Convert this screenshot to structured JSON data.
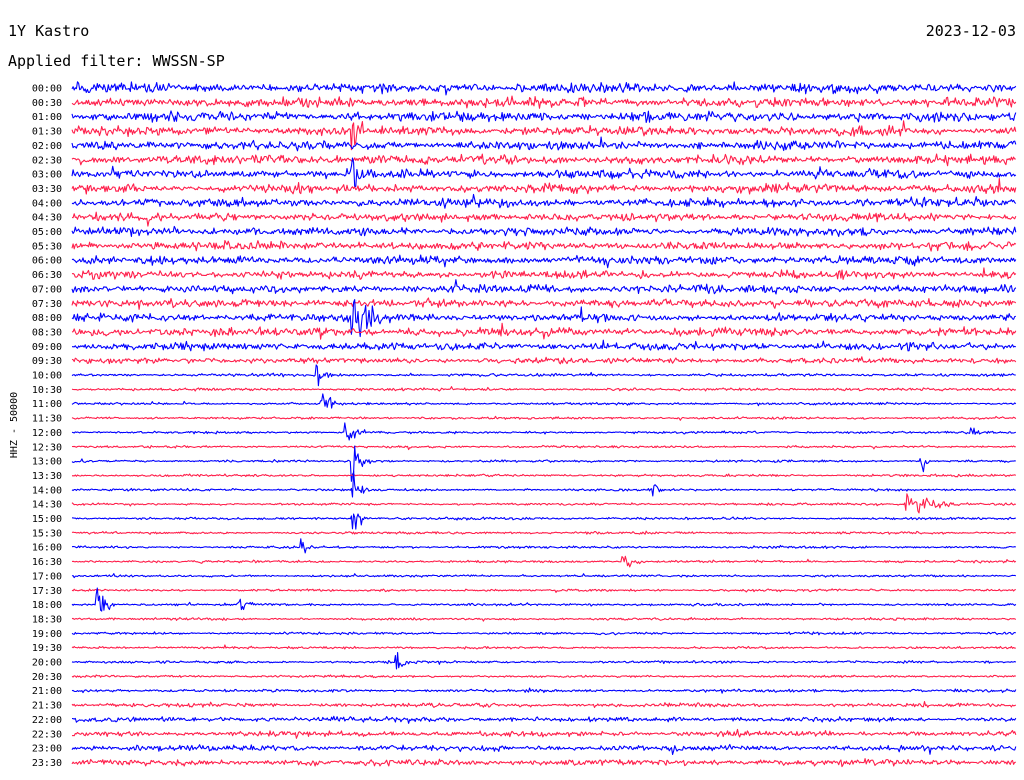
{
  "header": {
    "station": "1Y Kastro",
    "date": "2023-12-03",
    "filter": "Applied filter: WWSSN-SP"
  },
  "chart_data": {
    "type": "line",
    "title": "1Y Kastro",
    "subtitle": "Applied filter: WWSSN-SP",
    "date": "2023-12-03",
    "ylabel": "HHZ - 50000",
    "xlabel": "",
    "grid": false,
    "legend": "none",
    "trace_colors": [
      "#0000ff",
      "#ff1f4b"
    ],
    "row_minutes": 30,
    "ticks": [
      "00:00",
      "00:30",
      "01:00",
      "01:30",
      "02:00",
      "02:30",
      "03:00",
      "03:30",
      "04:00",
      "04:30",
      "05:00",
      "05:30",
      "06:00",
      "06:30",
      "07:00",
      "07:30",
      "08:00",
      "08:30",
      "09:00",
      "09:30",
      "10:00",
      "10:30",
      "11:00",
      "11:30",
      "12:00",
      "12:30",
      "13:00",
      "13:30",
      "14:00",
      "14:30",
      "15:00",
      "15:30",
      "16:00",
      "16:30",
      "17:00",
      "17:30",
      "18:00",
      "18:30",
      "19:00",
      "19:30",
      "20:00",
      "20:30",
      "21:00",
      "21:30",
      "22:00",
      "22:30",
      "23:00",
      "23:30"
    ],
    "noise_amplitude": [
      1.0,
      1.0,
      1.0,
      0.95,
      0.95,
      0.95,
      0.95,
      0.9,
      0.9,
      0.85,
      0.85,
      0.85,
      0.85,
      0.85,
      0.85,
      0.85,
      0.85,
      0.85,
      0.8,
      0.6,
      0.3,
      0.28,
      0.25,
      0.25,
      0.25,
      0.25,
      0.25,
      0.25,
      0.25,
      0.25,
      0.25,
      0.25,
      0.25,
      0.25,
      0.25,
      0.25,
      0.25,
      0.25,
      0.25,
      0.25,
      0.25,
      0.25,
      0.3,
      0.4,
      0.5,
      0.55,
      0.6,
      0.65
    ],
    "events": [
      {
        "row": 3,
        "minute": 8.9,
        "amplitude": 6.0,
        "duration_min": 0.6
      },
      {
        "row": 6,
        "minute": 8.9,
        "amplitude": 5.0,
        "duration_min": 0.6
      },
      {
        "row": 16,
        "minute": 8.9,
        "amplitude": 6.0,
        "duration_min": 1.5
      },
      {
        "row": 20,
        "minute": 7.8,
        "amplitude": 3.0,
        "duration_min": 0.5
      },
      {
        "row": 22,
        "minute": 7.9,
        "amplitude": 5.0,
        "duration_min": 0.5
      },
      {
        "row": 24,
        "minute": 8.7,
        "amplitude": 4.0,
        "duration_min": 0.6
      },
      {
        "row": 26,
        "minute": 8.9,
        "amplitude": 6.0,
        "duration_min": 0.6
      },
      {
        "row": 28,
        "minute": 8.9,
        "amplitude": 5.0,
        "duration_min": 0.5
      },
      {
        "row": 30,
        "minute": 8.9,
        "amplitude": 6.0,
        "duration_min": 0.5
      },
      {
        "row": 32,
        "minute": 7.3,
        "amplitude": 2.5,
        "duration_min": 0.4
      },
      {
        "row": 36,
        "minute": 0.8,
        "amplitude": 4.0,
        "duration_min": 0.6
      },
      {
        "row": 40,
        "minute": 10.3,
        "amplitude": 3.5,
        "duration_min": 0.4
      },
      {
        "row": 26,
        "minute": 27.0,
        "amplitude": 2.8,
        "duration_min": 0.3
      },
      {
        "row": 24,
        "minute": 28.6,
        "amplitude": 2.0,
        "duration_min": 0.3
      },
      {
        "row": 28,
        "minute": 18.5,
        "amplitude": 2.0,
        "duration_min": 0.3
      },
      {
        "row": 29,
        "minute": 26.5,
        "amplitude": 2.5,
        "duration_min": 2.0
      },
      {
        "row": 33,
        "minute": 17.5,
        "amplitude": 1.8,
        "duration_min": 0.8
      },
      {
        "row": 36,
        "minute": 5.3,
        "amplitude": 1.5,
        "duration_min": 0.8
      }
    ]
  }
}
